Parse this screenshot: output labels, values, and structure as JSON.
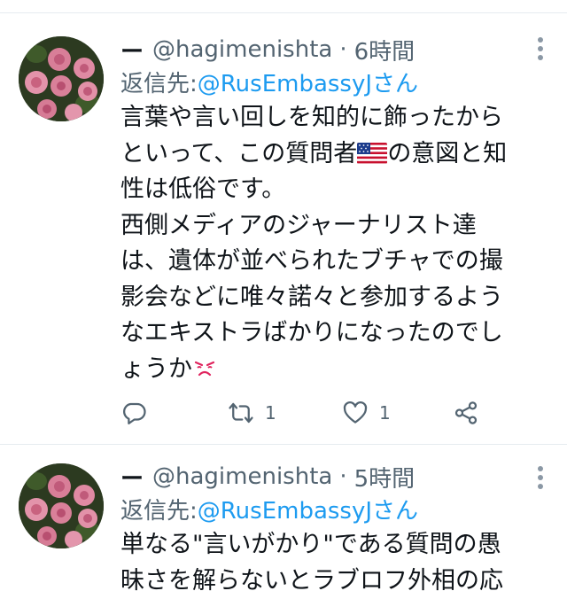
{
  "tweets": [
    {
      "display_name": "ー",
      "handle": "@hagimenishta",
      "separator": "·",
      "time": "6時間",
      "reply_label": "返信先: ",
      "reply_mention": "@RusEmbassyJさん",
      "lines": [
        "言葉や言い回しを知的に飾ったから",
        "といって、この質問者",
        "の意図と知",
        "性は低俗です。",
        "西側メディアのジャーナリスト達",
        "は、遺体が並べられたブチャでの撮",
        "影会などに唯々諾々と参加するよう",
        "なエキストラばかりになったのでし",
        "ょうか"
      ],
      "emoji_flag": "us-flag",
      "emoji_end": "angry-face",
      "retweets": "1",
      "likes": "1"
    },
    {
      "display_name": "ー",
      "handle": "@hagimenishta",
      "separator": "·",
      "time": "5時間",
      "reply_label": "返信先: ",
      "reply_mention": "@RusEmbassyJさん",
      "lines": [
        "単なる\"言いがかり\"である質問の愚",
        "昧さを解らないとラブロフ外相の応"
      ]
    }
  ],
  "icons": {
    "reply": "reply-icon",
    "retweet": "retweet-icon",
    "like": "heart-icon",
    "share": "share-icon",
    "more": "more-icon"
  },
  "colors": {
    "accent": "#1d9bf0",
    "secondary_text": "#536471",
    "primary_text": "#0f1419",
    "divider": "#e6ecf0"
  }
}
